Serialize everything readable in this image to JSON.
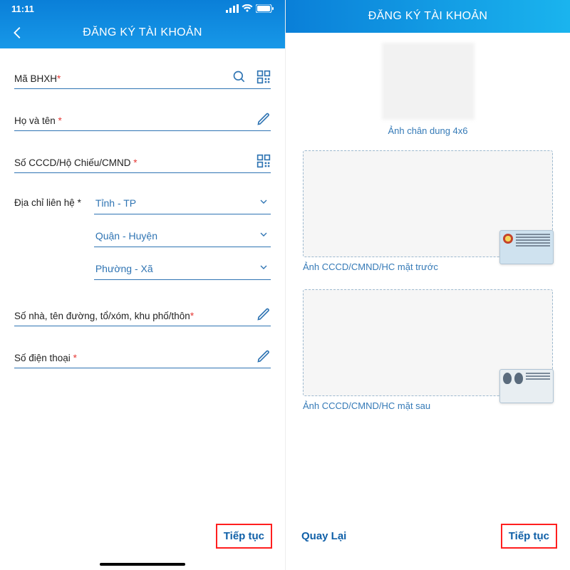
{
  "status": {
    "time": "11:11"
  },
  "header": {
    "title": "ĐĂNG KÝ TÀI KHOẢN"
  },
  "left": {
    "fields": {
      "bhxh_label": "Mã BHXH",
      "name_label": "Họ và tên ",
      "id_label": "Số CCCD/Hộ Chiếu/CMND ",
      "address_label": "Địa chỉ liên hệ ",
      "province": "Tỉnh - TP",
      "district": "Quận - Huyện",
      "ward": "Phường - Xã",
      "street_label": "Số nhà, tên đường, tổ/xóm, khu phố/thôn",
      "phone_label": "Số điện thoại "
    },
    "next": "Tiếp tục"
  },
  "right": {
    "portrait_caption": "Ảnh chân dung 4x6",
    "front_caption": "Ảnh CCCD/CMND/HC mặt trước",
    "back_caption": "Ảnh CCCD/CMND/HC mặt sau",
    "back": "Quay Lại",
    "next": "Tiếp tục"
  }
}
